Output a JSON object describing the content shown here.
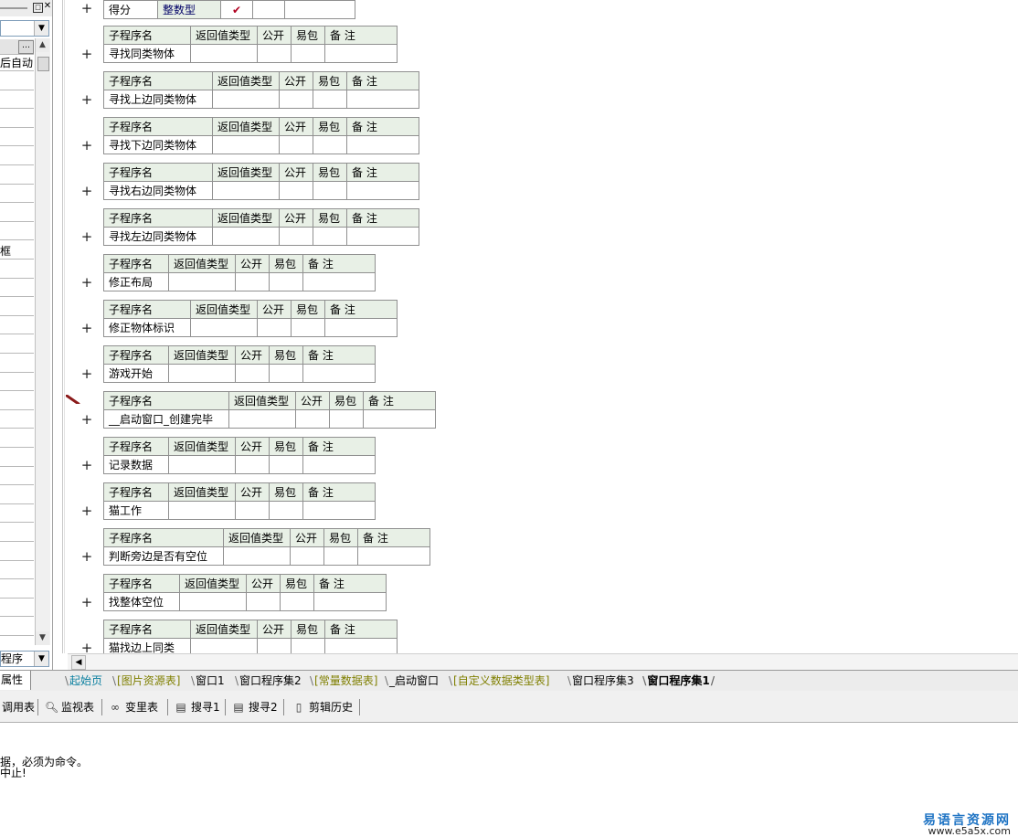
{
  "left_panel": {
    "rows": [
      "后自动",
      "",
      "",
      "",
      "",
      "",
      "",
      "",
      "",
      "",
      "框",
      "",
      "",
      "",
      "",
      "",
      "",
      "",
      "",
      "",
      "",
      "",
      "",
      "",
      "",
      "",
      "",
      "",
      "",
      "",
      "",
      ""
    ],
    "bottom_combo": "程序",
    "tab": "属性"
  },
  "partial_top": {
    "name": "得分",
    "type": "整数型",
    "public_check": "✔"
  },
  "headers": {
    "name": "子程序名",
    "ret": "返回值类型",
    "public": "公开",
    "easy": "易包",
    "note": "备 注"
  },
  "subroutines": [
    {
      "name": "寻找同类物体"
    },
    {
      "name": "寻找上边同类物体"
    },
    {
      "name": "寻找下边同类物体"
    },
    {
      "name": "寻找右边同类物体"
    },
    {
      "name": "寻找左边同类物体"
    },
    {
      "name": "修正布局"
    },
    {
      "name": "修正物体标识"
    },
    {
      "name": "游戏开始"
    },
    {
      "name": "__启动窗口_创建完毕"
    },
    {
      "name": "记录数据"
    },
    {
      "name": "猫工作"
    },
    {
      "name": "判断旁边是否有空位"
    },
    {
      "name": "找整体空位"
    },
    {
      "name": "猫找边上同类"
    }
  ],
  "tabs": [
    {
      "label": "起始页",
      "style": "teal"
    },
    {
      "label": "[图片资源表]",
      "style": "olive"
    },
    {
      "label": "窗口1",
      "style": "normal"
    },
    {
      "label": "窗口程序集2",
      "style": "normal"
    },
    {
      "label": "[常量数据表]",
      "style": "olive"
    },
    {
      "label": "_启动窗口",
      "style": "normal"
    },
    {
      "label": "[自定义数据类型表]",
      "style": "olive"
    },
    {
      "label": "窗口程序集3",
      "style": "normal"
    },
    {
      "label": "窗口程序集1",
      "style": "active"
    }
  ],
  "toolbar": {
    "items": [
      "调用表",
      "监视表",
      "变里表",
      "搜寻1",
      "搜寻2",
      "剪辑历史"
    ]
  },
  "output": {
    "lines": [
      "据，必须为命令。",
      "中止!"
    ]
  },
  "watermark": {
    "line1": "易语言资源网",
    "line2": "www.e5a5x.com"
  }
}
